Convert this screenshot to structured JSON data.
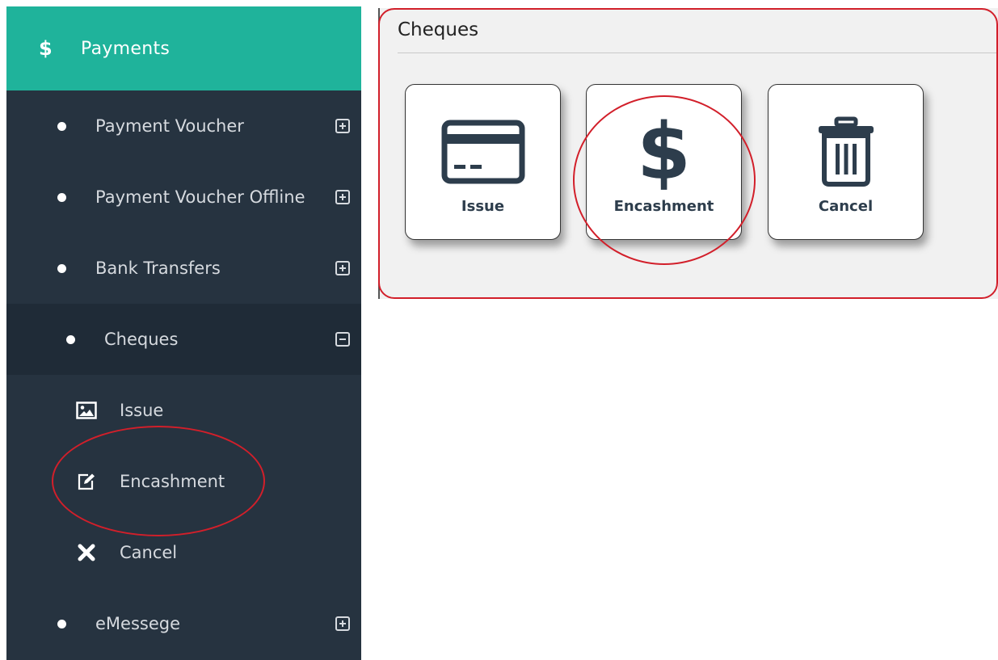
{
  "sidebar": {
    "header": {
      "icon": "dollar-icon",
      "symbol": "$",
      "title": "Payments",
      "color": "#1fb39b"
    },
    "items": [
      {
        "label": "Payment Voucher",
        "toggle": "plus"
      },
      {
        "label": "Payment Voucher Offline",
        "toggle": "plus"
      },
      {
        "label": "Bank Transfers",
        "toggle": "plus"
      },
      {
        "label": "Cheques",
        "toggle": "minus",
        "active": true
      }
    ],
    "sub_items": [
      {
        "label": "Issue",
        "icon": "image-icon"
      },
      {
        "label": "Encashment",
        "icon": "edit-icon"
      },
      {
        "label": "Cancel",
        "icon": "close-icon"
      }
    ],
    "footer_item": {
      "label": "eMessege",
      "toggle": "plus"
    },
    "background": "#263340"
  },
  "panel": {
    "title": "Cheques",
    "tiles": [
      {
        "label": "Issue",
        "icon": "credit-card-icon"
      },
      {
        "label": "Encashment",
        "icon": "dollar-icon",
        "symbol": "$"
      },
      {
        "label": "Cancel",
        "icon": "trash-icon"
      }
    ]
  },
  "annotation_color": "#d21f2a"
}
